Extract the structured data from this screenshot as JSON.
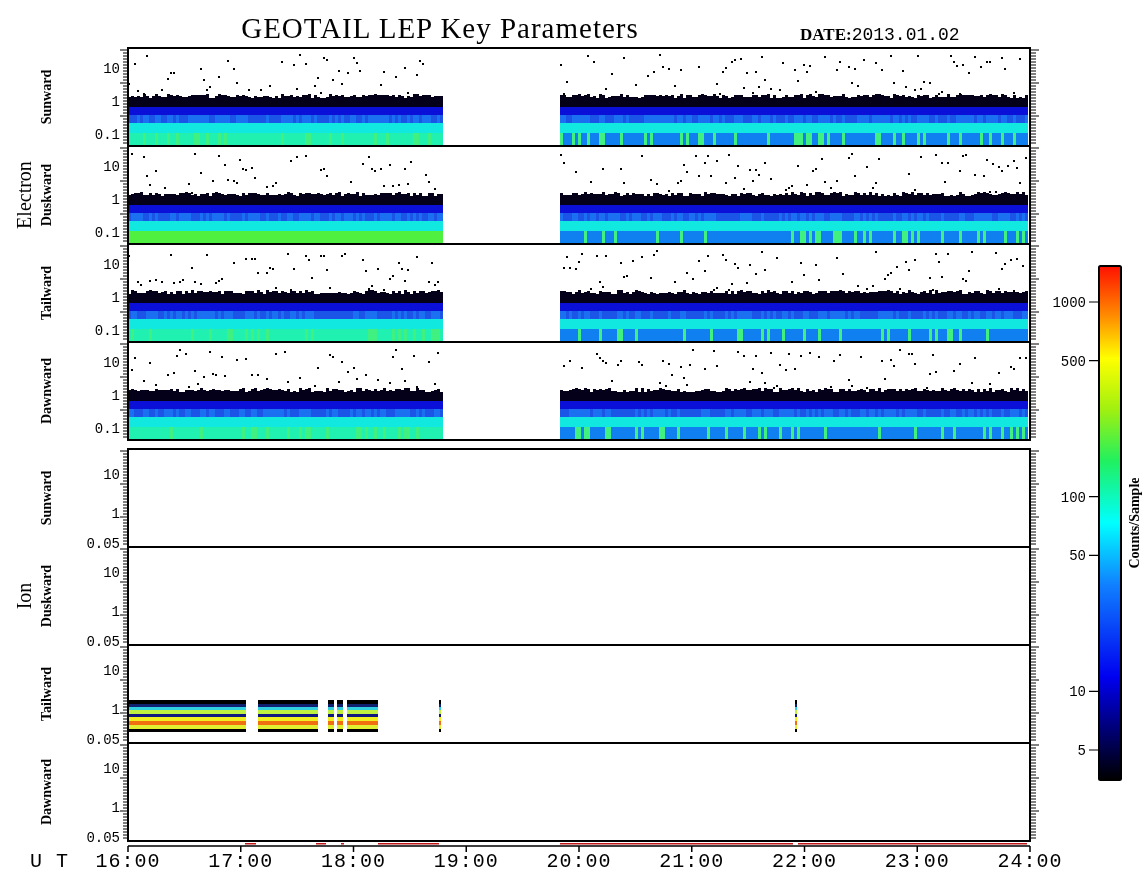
{
  "title": "GEOTAIL LEP Key Parameters",
  "date_label": "DATE:",
  "date": "2013.01.02",
  "groups": [
    {
      "label": "Electron",
      "panels": [
        {
          "label": "Sunward",
          "kind": "electron",
          "yticks": [
            "10",
            "1",
            "0.1"
          ]
        },
        {
          "label": "Duskward",
          "kind": "electron",
          "yticks": [
            "10",
            "1",
            "0.1"
          ]
        },
        {
          "label": "Tailward",
          "kind": "electron",
          "yticks": [
            "10",
            "1",
            "0.1"
          ]
        },
        {
          "label": "Dawnward",
          "kind": "electron",
          "yticks": [
            "10",
            "1",
            "0.1"
          ]
        }
      ]
    },
    {
      "label": "Ion",
      "panels": [
        {
          "label": "Sunward",
          "kind": "empty",
          "yticks": [
            "10",
            "1",
            "0.05"
          ]
        },
        {
          "label": "Duskward",
          "kind": "empty",
          "yticks": [
            "10",
            "1",
            "0.05"
          ]
        },
        {
          "label": "Tailward",
          "kind": "ion",
          "yticks": [
            "10",
            "1",
            "0.05"
          ]
        },
        {
          "label": "Dawnward",
          "kind": "empty",
          "yticks": [
            "10",
            "1",
            "0.05"
          ]
        }
      ]
    }
  ],
  "x_axis": {
    "label": "U T",
    "ticks": [
      "16:00",
      "17:00",
      "18:00",
      "19:00",
      "20:00",
      "21:00",
      "22:00",
      "23:00",
      "24:00"
    ]
  },
  "colorbar": {
    "label": "Counts/Sample",
    "ticks": [
      "1000",
      "500",
      "100",
      "50",
      "10",
      "5"
    ]
  }
}
